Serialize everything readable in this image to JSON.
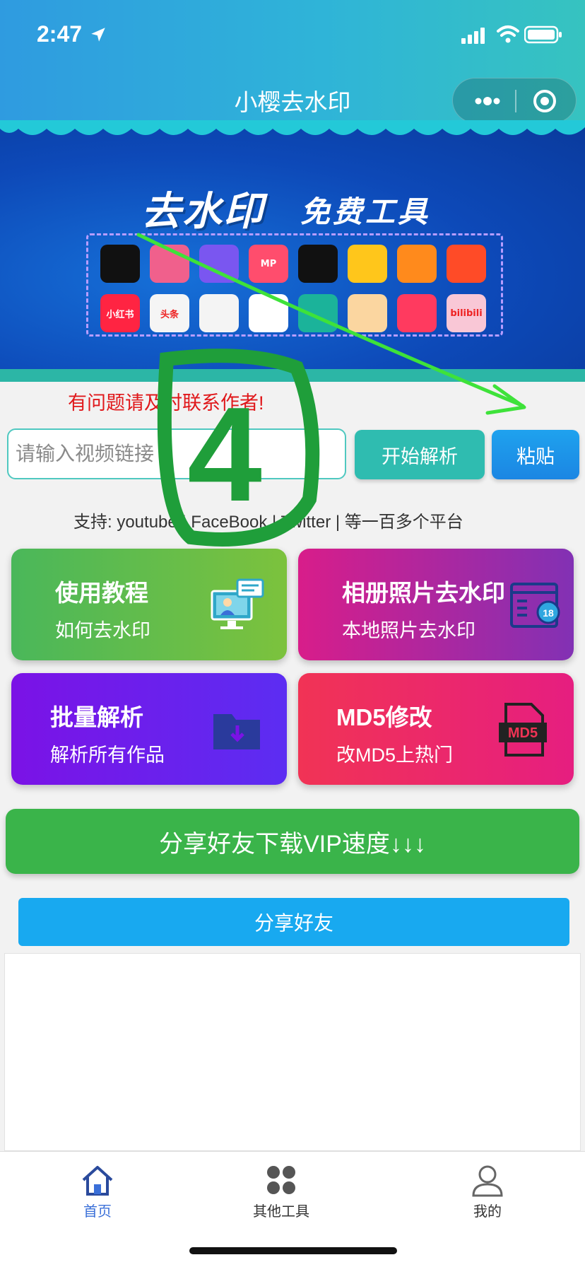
{
  "status_bar": {
    "time": "2:47",
    "icons": [
      "location-arrow-icon",
      "signal-icon",
      "wifi-icon",
      "battery-icon"
    ]
  },
  "nav": {
    "title": "小樱去水印",
    "capsule_icons": [
      "more-icon",
      "close-target-icon"
    ]
  },
  "banner": {
    "title": "去水印",
    "subtitle": "免费工具",
    "apps": [
      {
        "icon": "douyin-icon",
        "label": "",
        "color": "#111111"
      },
      {
        "icon": "weishi-icon",
        "label": "",
        "color": "#f0608c"
      },
      {
        "icon": "kuaishou-play-icon",
        "label": "",
        "color": "#7a56f0"
      },
      {
        "icon": "mp-icon",
        "label": "MP",
        "color": "#ff4d6d"
      },
      {
        "icon": "face-icon",
        "label": "",
        "color": "#111111"
      },
      {
        "icon": "chick-icon",
        "label": "",
        "color": "#ffc61b"
      },
      {
        "icon": "kuaishou-icon",
        "label": "",
        "color": "#ff8a1c"
      },
      {
        "icon": "fire-icon",
        "label": "",
        "color": "#ff4b27"
      },
      {
        "icon": "xiaohongshu-icon",
        "label": "小红书",
        "color": "#ff2442"
      },
      {
        "icon": "toutiao-icon",
        "label": "头条",
        "color": "#f5f5f5"
      },
      {
        "icon": "weishi-play-icon",
        "label": "",
        "color": "#f4f4f4"
      },
      {
        "icon": "chat-icon",
        "label": "",
        "color": "#ffffff"
      },
      {
        "icon": "owl-icon",
        "label": "",
        "color": "#1bb39a"
      },
      {
        "icon": "cartoon-icon",
        "label": "",
        "color": "#fbd6a0"
      },
      {
        "icon": "play-circle-icon",
        "label": "",
        "color": "#ff3a5f"
      },
      {
        "icon": "bilibili-icon",
        "label": "bilibili",
        "color": "#f9c7d6"
      }
    ],
    "colors": {
      "main": "#0d49b8",
      "frame": "#b79dff"
    }
  },
  "notice": "有问题请及时联系作者!",
  "search": {
    "placeholder": "请输入视频链接",
    "value": "",
    "parse_label": "开始解析",
    "paste_label": "粘贴"
  },
  "support_text": "支持:  youtube | FaceBook | Twitter | 等一百多个平台",
  "cards": {
    "tutorial": {
      "title": "使用教程",
      "subtitle": "如何去水印",
      "icon": "monitor-chat-icon"
    },
    "album": {
      "title": "相册照片去水印",
      "subtitle": "本地照片去水印",
      "icon": "photo-list-icon"
    },
    "batch": {
      "title": "批量解析",
      "subtitle": "解析所有作品",
      "icon": "folder-download-icon"
    },
    "md5": {
      "title": "MD5修改",
      "subtitle": "改MD5上热门",
      "icon": "md5-file-icon"
    }
  },
  "vip_share": "分享好友下载VIP速度↓↓↓",
  "share_button": "分享好友",
  "tabbar": {
    "home": "首页",
    "tools": "其他工具",
    "me": "我的",
    "active_color": "#3a6fd8"
  },
  "annotation": {
    "handwritten": "4",
    "arrow_color": "#3ee23a",
    "circle_color": "#1f9e3a"
  }
}
